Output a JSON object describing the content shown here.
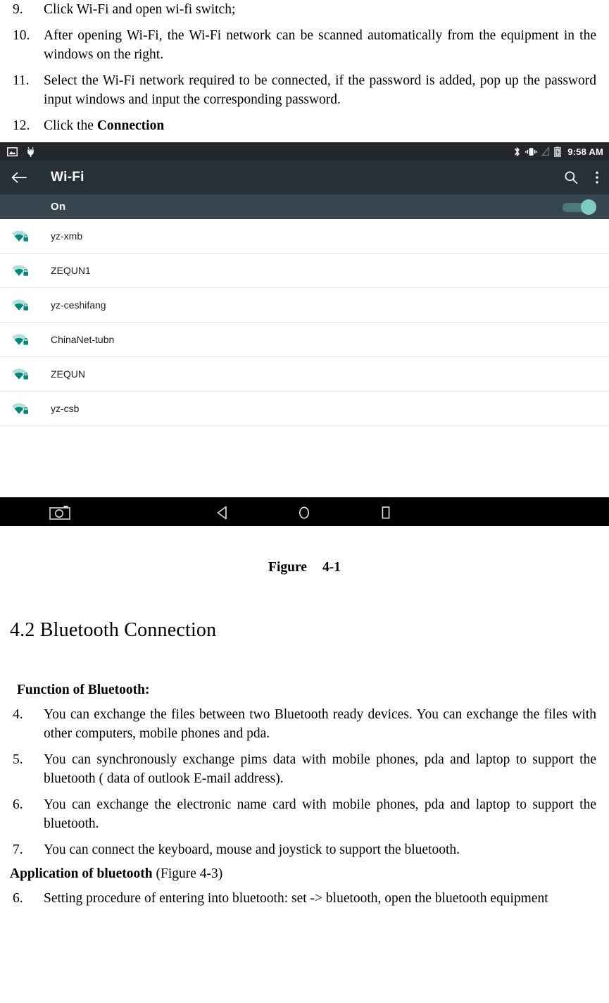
{
  "document": {
    "top_list": [
      {
        "num": "9.",
        "text": "Click Wi-Fi and open wi-fi switch;",
        "bold_tail": ""
      },
      {
        "num": "10.",
        "text": "After opening Wi-Fi, the Wi-Fi network can be scanned automatically from the equipment in the windows on the right.",
        "bold_tail": ""
      },
      {
        "num": "11.",
        "text": "Select the Wi-Fi network required to be connected, if the password is added, pop up the password input windows and input the corresponding password.",
        "bold_tail": ""
      },
      {
        "num": "12.",
        "text": "Click the ",
        "bold_tail": "Connection"
      }
    ],
    "figure_caption_label": "Figure",
    "figure_caption_number": "4-1",
    "section_heading": "4.2 Bluetooth Connection",
    "function_heading": "Function of Bluetooth:",
    "function_list": [
      {
        "num": "4.",
        "text": "You can exchange the files between two Bluetooth ready devices. You can exchange the files with other computers, mobile phones and pda."
      },
      {
        "num": "5.",
        "text": "You can synchronously exchange pims data with mobile phones, pda and laptop to support the bluetooth ( data of outlook E-mail address)."
      },
      {
        "num": "6.",
        "text": "You can exchange the electronic name card with mobile phones, pda and laptop to support the bluetooth."
      },
      {
        "num": "7.",
        "text": "You can connect the keyboard, mouse and joystick to support the bluetooth."
      }
    ],
    "application_heading_bold": "Application of bluetooth",
    "application_heading_rest": " (Figure 4-3)",
    "application_list": [
      {
        "num": "6.",
        "text": "Setting procedure of entering into bluetooth: set -> bluetooth, open the bluetooth equipment"
      }
    ]
  },
  "android": {
    "status_bar": {
      "clock": "9:58 AM",
      "left_icons": [
        "screenshot-icon",
        "usb-android-icon"
      ],
      "right_icons": [
        "bluetooth-icon",
        "vibrate-icon",
        "no-signal-icon",
        "battery-charging-icon"
      ],
      "background_color": "#23272a"
    },
    "toolbar": {
      "back_label": "back-arrow",
      "title": "Wi-Fi",
      "search_label": "search-icon",
      "overflow_label": "more-options-icon",
      "background_color": "#263238"
    },
    "wifi_toggle_row": {
      "label": "On",
      "state": "on",
      "background_color": "#37474f",
      "thumb_color": "#80cbc4",
      "track_color": "#4d7a78"
    },
    "networks": [
      {
        "ssid": "yz-xmb",
        "secured": true
      },
      {
        "ssid": "ZEQUN1",
        "secured": true
      },
      {
        "ssid": "yz-ceshifang",
        "secured": true
      },
      {
        "ssid": "ChinaNet-tubn",
        "secured": true
      },
      {
        "ssid": "ZEQUN",
        "secured": true
      },
      {
        "ssid": "yz-csb",
        "secured": true
      }
    ],
    "nav_bar": {
      "background_color": "#000000",
      "buttons": [
        "screenshot-camera-icon",
        "back-nav-icon",
        "home-nav-icon",
        "recents-nav-icon"
      ]
    },
    "accent_color": "#009688"
  }
}
